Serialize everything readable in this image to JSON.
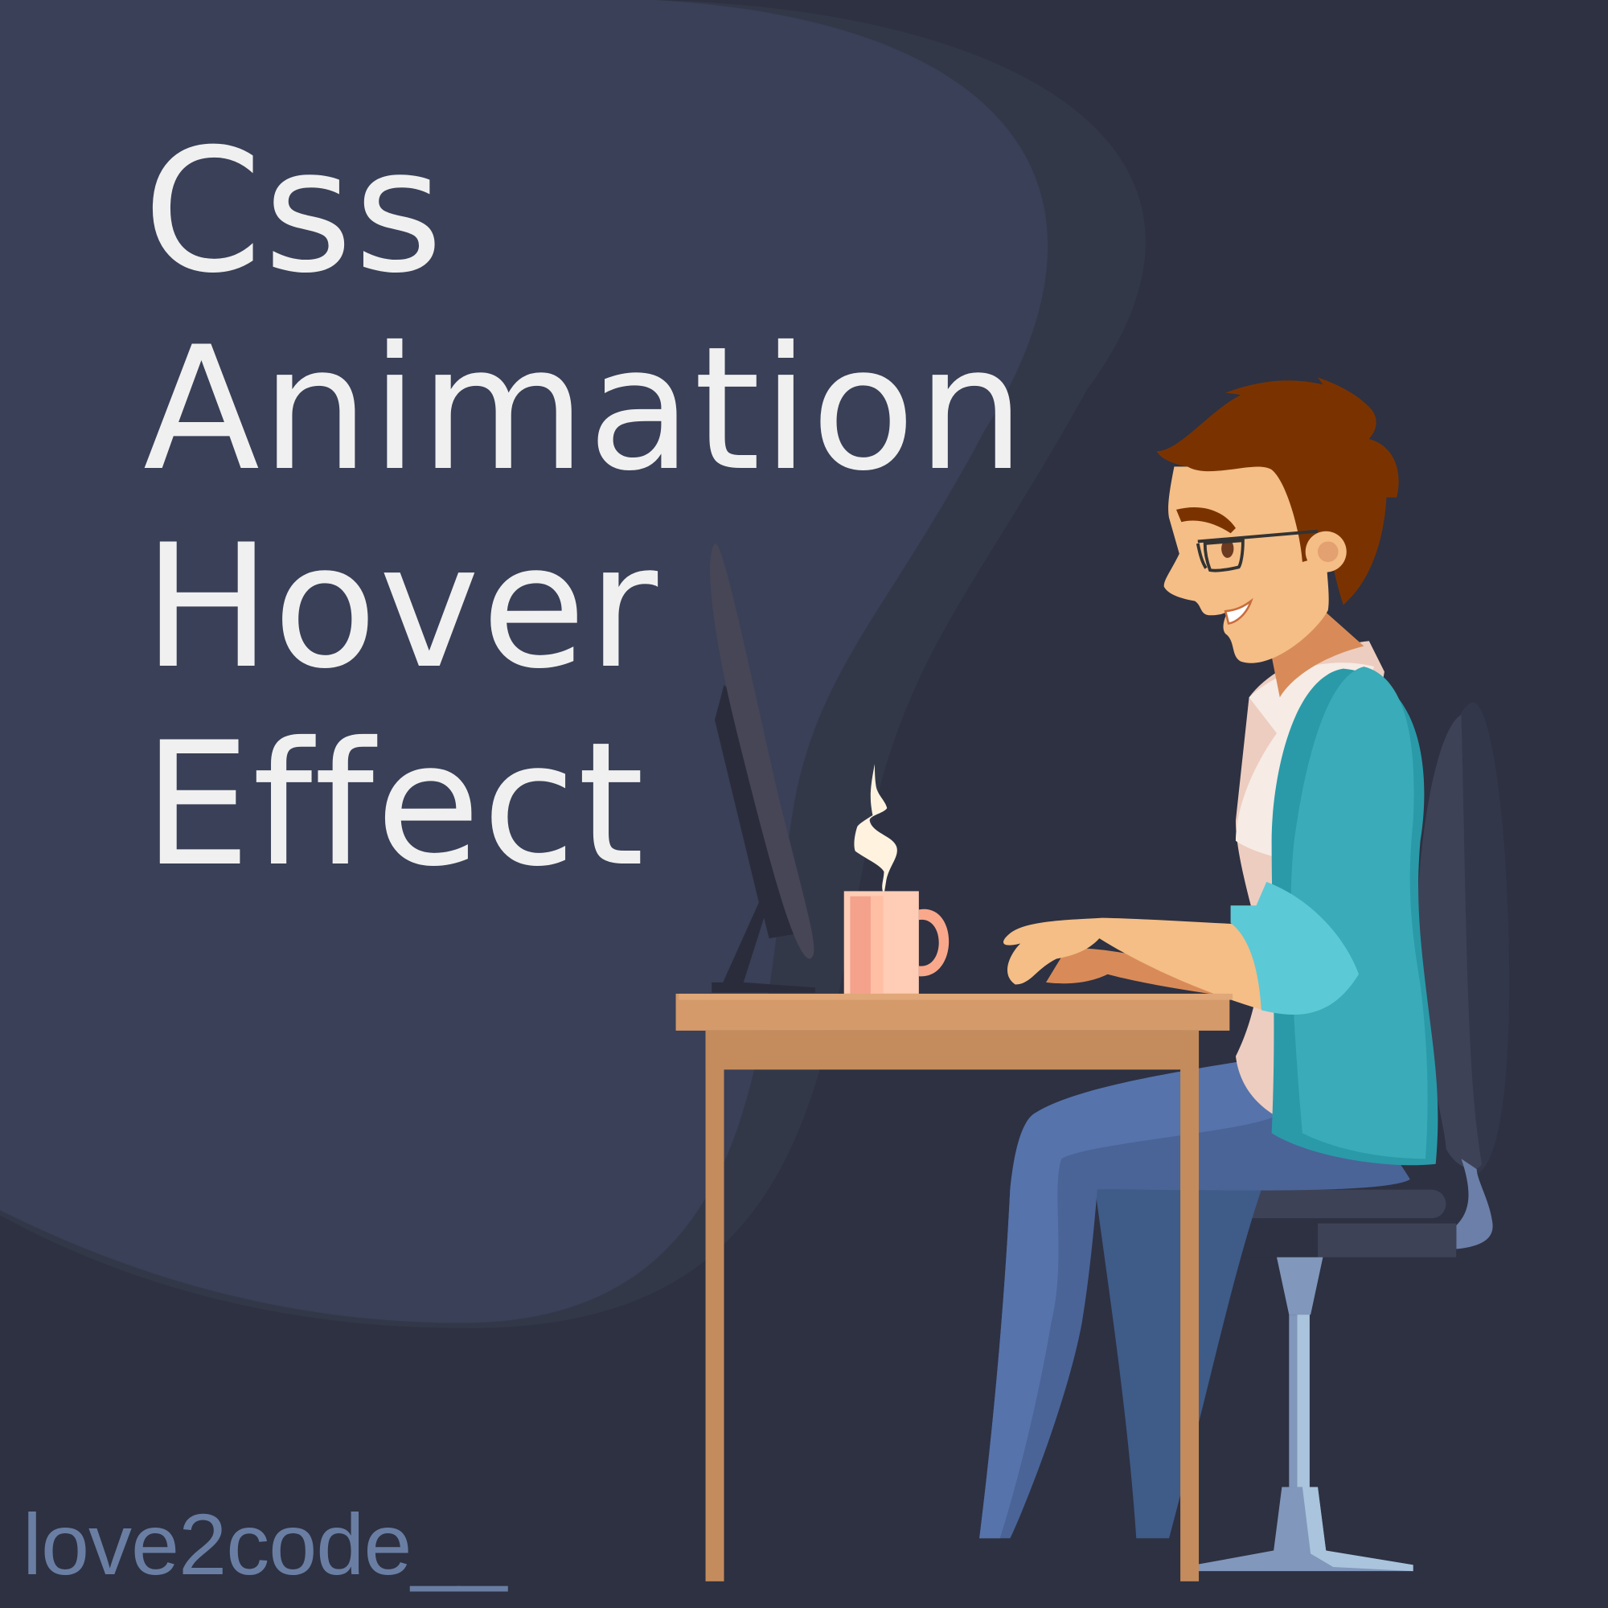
{
  "title": {
    "lines": [
      "Css",
      "Animation",
      "Hover",
      "Effect"
    ]
  },
  "brand": {
    "text": "love2code__"
  },
  "colors": {
    "background": "#2d3142",
    "blob": "#394057",
    "title_text": "#f0f0f0",
    "brand_text": "#6a7ea3",
    "desk": "#d49a6a",
    "jacket": "#3aabb8",
    "hair": "#7a3300",
    "skin": "#f4be86",
    "pants": "#5673ab"
  },
  "illustration": {
    "subject": "developer-at-desk",
    "icons": [
      "monitor",
      "coffee-mug",
      "desk",
      "office-chair",
      "person"
    ]
  }
}
